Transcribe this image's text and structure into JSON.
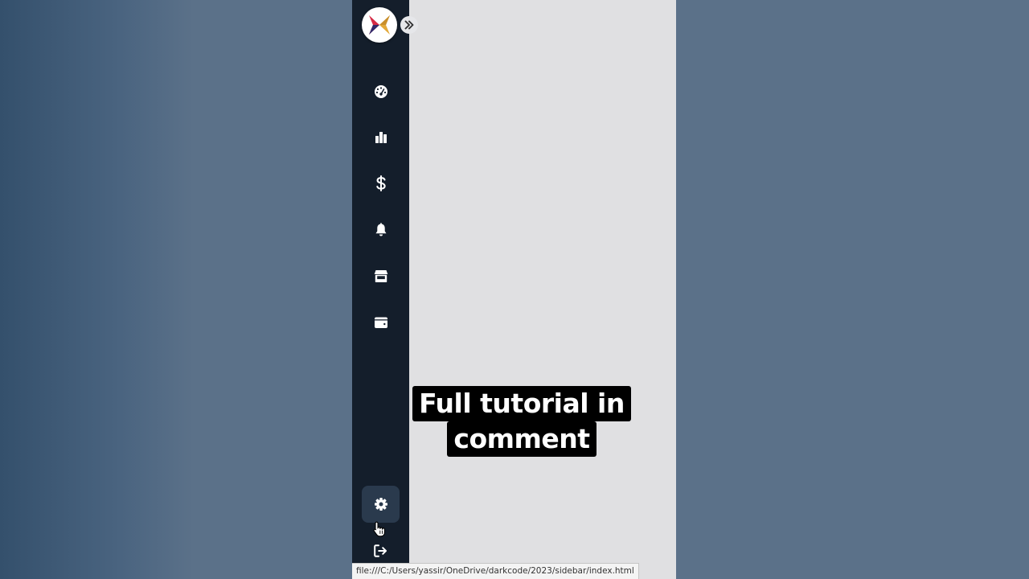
{
  "sidebar": {
    "logo": {
      "icon": "brand-logo-icon",
      "colors": [
        "#d62a45",
        "#2f2a6b",
        "#e3a93a"
      ]
    },
    "toggle": {
      "icon": "chevrons-right-icon"
    },
    "items": [
      {
        "id": "dashboard",
        "icon": "gauge-icon"
      },
      {
        "id": "analytics",
        "icon": "bar-chart-icon"
      },
      {
        "id": "payments",
        "icon": "dollar-icon"
      },
      {
        "id": "notifications",
        "icon": "bell-icon"
      },
      {
        "id": "store",
        "icon": "store-icon"
      },
      {
        "id": "wallet",
        "icon": "wallet-icon"
      }
    ],
    "settings": {
      "icon": "gear-icon",
      "active": true
    },
    "logout": {
      "icon": "logout-icon"
    }
  },
  "status_bar": {
    "url": "file:///C:/Users/yassir/OneDrive/darkcode/2023/sidebar/index.html"
  },
  "overlay": {
    "caption_line1": "Full tutorial in",
    "caption_line2": "comment"
  },
  "colors": {
    "sidebar_bg": "#141e2b",
    "active_bg": "#2a3a4d",
    "content_bg": "#e0e0e2",
    "icon": "#ffffff"
  }
}
